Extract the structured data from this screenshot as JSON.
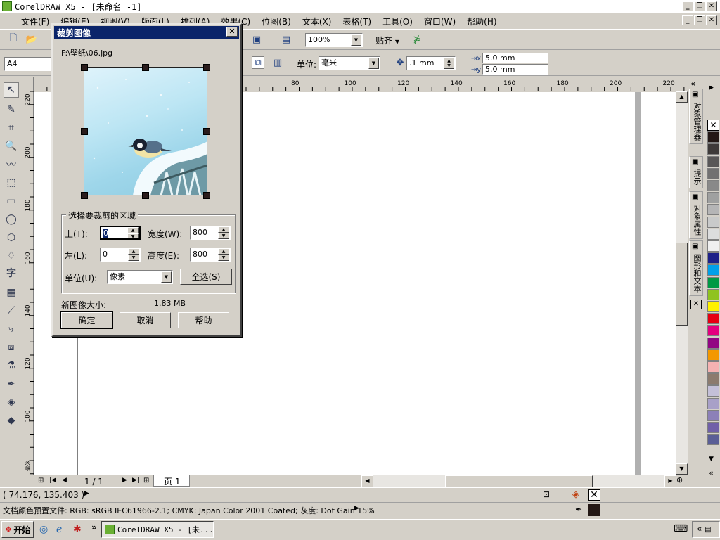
{
  "window": {
    "title": "CorelDRAW X5 - [未命名 -1]"
  },
  "menu": [
    "文件(F)",
    "编辑(E)",
    "视图(V)",
    "版面(L)",
    "排列(A)",
    "效果(C)",
    "位图(B)",
    "文本(X)",
    "表格(T)",
    "工具(O)",
    "窗口(W)",
    "帮助(H)"
  ],
  "toolbar": {
    "zoom": "100%",
    "snap_label": "贴齐"
  },
  "propbar": {
    "page_size": "A4",
    "unit_label": "单位:",
    "unit_value": "毫米",
    "nudge": ".1 mm",
    "dup_x": "5.0 mm",
    "dup_y": "5.0 mm"
  },
  "rulers": {
    "h_ticks": [
      "80",
      "100",
      "120",
      "140",
      "160",
      "180",
      "200",
      "220"
    ],
    "v_ticks": [
      "220",
      "200",
      "180",
      "160",
      "140",
      "120",
      "100"
    ],
    "unit": "毫米"
  },
  "docker": {
    "tabs": [
      "对象管理器",
      "提示",
      "对象属性",
      "图形和文本"
    ]
  },
  "palette_colors": [
    "#ffffff",
    "#231815",
    "#3e3a39",
    "#595757",
    "#727171",
    "#898989",
    "#9fa0a0",
    "#b5b5b6",
    "#c9caca",
    "#dcdddd",
    "#efefef",
    "#1d2088",
    "#00a0e9",
    "#009944",
    "#8fc31f",
    "#fff100",
    "#e60012",
    "#e4007f",
    "#920783",
    "#f39800",
    "#f5b2b2",
    "#8c7b6e",
    "#c4c0d8",
    "#a8a0c8",
    "#8c80b8",
    "#7060a8",
    "#5a5e96"
  ],
  "pagebar": {
    "counter": "1 / 1",
    "page_tab": "页 1"
  },
  "status": {
    "coords": "( 74.176, 135.403 )",
    "color_profile": "文档颜色预置文件: RGB: sRGB IEC61966-2.1; CMYK: Japan Color 2001 Coated; 灰度: Dot Gain 15%"
  },
  "taskbar": {
    "start": "开始",
    "task": "CorelDRAW X5 - [未..."
  },
  "dialog": {
    "title": "裁剪图像",
    "file_path": "F:\\壁纸\\06.jpg",
    "group_title": "选择要裁剪的区域",
    "top_label": "上(T):",
    "top_value": "0",
    "width_label": "宽度(W):",
    "width_value": "800",
    "left_label": "左(L):",
    "left_value": "0",
    "height_label": "高度(E):",
    "height_value": "800",
    "unit_label": "单位(U):",
    "unit_value": "像素",
    "select_all": "全选(S)",
    "size_label": "新图像大小:",
    "size_value": "1.83 MB",
    "ok": "确定",
    "cancel": "取消",
    "help": "帮助"
  }
}
